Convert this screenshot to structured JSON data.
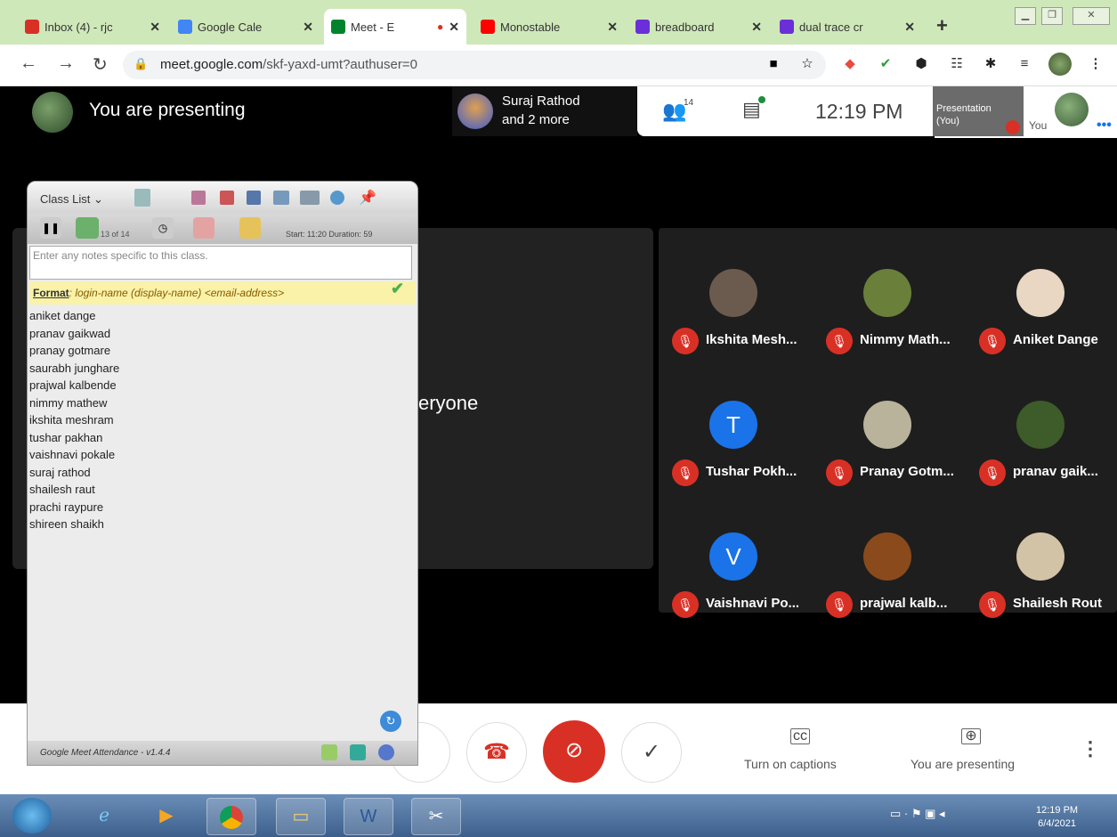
{
  "tabs": [
    {
      "label": "Inbox (4) - rjc",
      "icon": "gmail-icon",
      "color": "#d93025"
    },
    {
      "label": "Google Cale",
      "icon": "google-calendar-icon",
      "color": "#4285f4"
    },
    {
      "label": "Meet - E",
      "icon": "google-meet-icon",
      "color": "#00832d",
      "active": true
    },
    {
      "label": "Monostable",
      "icon": "youtube-icon",
      "color": "#ff0000"
    },
    {
      "label": "breadboard",
      "icon": "bookmark-app-icon",
      "color": "#6b2fd9"
    },
    {
      "label": "dual trace cr",
      "icon": "bookmark-app-icon",
      "color": "#6b2fd9"
    }
  ],
  "new_tab": "+",
  "address_bar": {
    "host": "meet.google.com",
    "path": "/skf-yaxd-umt?authuser=0"
  },
  "meet": {
    "you_are_presenting_title": "You are presenting",
    "presenter_chip": {
      "line1": "Suraj Rathod",
      "line2": "and 2 more"
    },
    "people_count": "14",
    "clock": "12:19 PM",
    "presentation_thumb": {
      "line1": "Presentation",
      "line2": "(You)"
    },
    "self_label": "You",
    "main_tile_text": "eryone",
    "participants": [
      {
        "name": "Ikshita Mesh...",
        "avatar": "photo",
        "color": "#6b5a4e"
      },
      {
        "name": "Nimmy Math...",
        "avatar": "photo",
        "color": "#6a7f3a"
      },
      {
        "name": "Aniket Dange",
        "avatar": "photo",
        "color": "#e9d6c3"
      },
      {
        "name": "Tushar Pokh...",
        "avatar": "T",
        "color": "#1a73e8"
      },
      {
        "name": "Pranay Gotm...",
        "avatar": "photo",
        "color": "#b9b39c"
      },
      {
        "name": "pranav gaik...",
        "avatar": "photo",
        "color": "#3d5c2a"
      },
      {
        "name": "Vaishnavi Po...",
        "avatar": "V",
        "color": "#1a73e8"
      },
      {
        "name": "prajwal kalb...",
        "avatar": "photo",
        "color": "#8a4a1c"
      },
      {
        "name": "Shailesh Rout",
        "avatar": "photo",
        "color": "#d3c3a6"
      }
    ],
    "controls": {
      "captions_label": "Turn on captions",
      "presenting_label": "You are presenting"
    }
  },
  "attendance_panel": {
    "title": "Class List",
    "stats": "13 of 14",
    "stats_detail": "Start: 11:20  Duration: 59",
    "notes_placeholder": "Enter any notes specific to this class.",
    "format_label": "Format",
    "format_value": ": login-name (display-name) <email-address>",
    "roster": [
      "aniket dange",
      "pranav gaikwad",
      "pranay gotmare",
      "saurabh junghare",
      "prajwal kalbende",
      "nimmy mathew",
      "ikshita meshram",
      "tushar pakhan",
      "vaishnavi pokale",
      "suraj rathod",
      "shailesh raut",
      "prachi raypure",
      "shireen shaikh"
    ],
    "version": "Google Meet Attendance - v1.4.4"
  },
  "taskbar": {
    "time": "12:19 PM",
    "date": "6/4/2021"
  }
}
